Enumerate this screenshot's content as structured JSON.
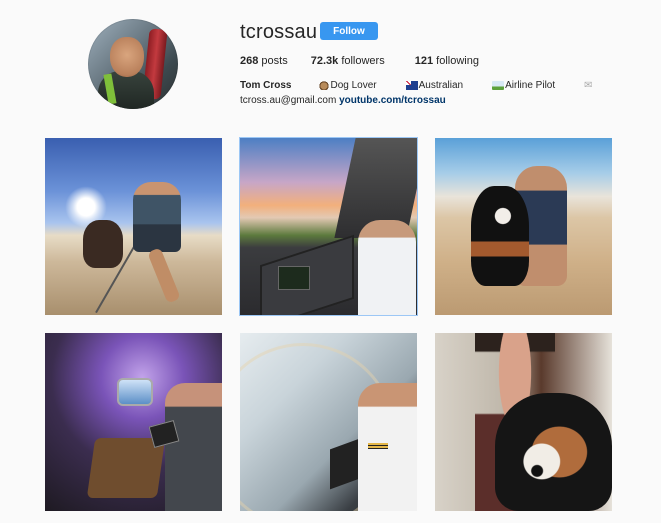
{
  "profile": {
    "username": "tcrossau",
    "follow_label": "Follow",
    "stats": {
      "posts_value": "268",
      "posts_label": "posts",
      "followers_value": "72.3k",
      "followers_label": "followers",
      "following_value": "121",
      "following_label": "following"
    },
    "bio": {
      "name": "Tom Cross",
      "tags": [
        "Dog Lover",
        "Australian",
        "Airline Pilot"
      ],
      "tag_icons": [
        "dog-emoji-icon",
        "australia-flag-icon",
        "airplane-emoji-icon"
      ],
      "envelope_icon": "✉",
      "email": "tcross.au@gmail.com",
      "link": "youtube.com/tcrossau"
    }
  },
  "posts": [
    {
      "subject": "beach-selfie-with-dog"
    },
    {
      "subject": "cockpit-sunset"
    },
    {
      "subject": "beach-with-dog"
    },
    {
      "subject": "airplane-cabin"
    },
    {
      "subject": "cockpit-pilot"
    },
    {
      "subject": "man-with-dog"
    }
  ],
  "colors": {
    "follow_button": "#3897f0",
    "link": "#003569",
    "background": "#fafafa"
  }
}
